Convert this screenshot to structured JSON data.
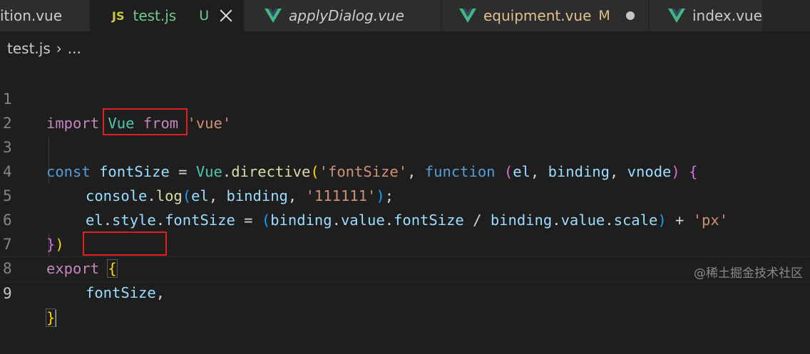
{
  "tabs": [
    {
      "name": "ition.vue",
      "kind": "vue-partial"
    },
    {
      "name": "test.js",
      "badge": "JS",
      "status": "U",
      "active": true
    },
    {
      "name": "applyDialog.vue",
      "italic": true
    },
    {
      "name": "equipment.vue",
      "status": "M",
      "modified_dot": true
    },
    {
      "name": "index.vue"
    }
  ],
  "breadcrumb": {
    "file": "test.js",
    "more": "..."
  },
  "line_numbers": [
    "1",
    "2",
    "3",
    "4",
    "5",
    "6",
    "7",
    "8",
    "9"
  ],
  "code": {
    "l1": {
      "import": "import",
      "vue": "Vue",
      "from": "from",
      "str": "'vue'"
    },
    "l3": {
      "const": "const",
      "name": "fontSize",
      "eq": " = ",
      "vue": "Vue",
      "dot": ".",
      "directive": "directive",
      "open": "(",
      "str": "'fontSize'",
      "comma": ", ",
      "function": "function",
      "space": " ",
      "paren_open": "(",
      "el": "el",
      "c1": ", ",
      "binding": "binding",
      "c2": ", ",
      "vnode": "vnode",
      "paren_close": ")",
      "brace": "{"
    },
    "l4": {
      "console": "console",
      "dot": ".",
      "log": "log",
      "open": "(",
      "el": "el",
      "c1": ", ",
      "binding": "binding",
      "c2": ", ",
      "str": "'111111'",
      "close": ")",
      "semi": ";"
    },
    "l5": {
      "el": "el",
      "d1": ".",
      "style": "style",
      "d2": ".",
      "fontSize": "fontSize",
      "eq": " = ",
      "open": "(",
      "binding1": "binding",
      "d3": ".",
      "value1": "value",
      "d4": ".",
      "fontSize2": "fontSize",
      "div": " / ",
      "binding2": "binding",
      "d5": ".",
      "value2": "value",
      "d6": ".",
      "scale": "scale",
      "close": ")",
      "plus": " + ",
      "str": "'px'"
    },
    "l6": {
      "brace": "}",
      "paren": ")"
    },
    "l7": {
      "export": "export",
      "brace": "{"
    },
    "l8": {
      "name": "fontSize",
      "comma": ","
    },
    "l9": {
      "brace": "}"
    }
  },
  "watermark": "@稀土掘金技术社区",
  "colors": {
    "highlight_box": "#e02020",
    "vue_green": "#41b883"
  }
}
